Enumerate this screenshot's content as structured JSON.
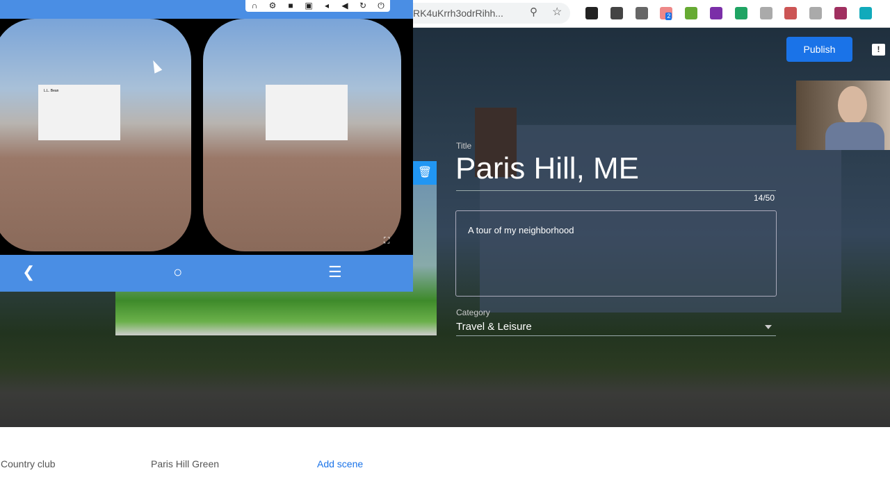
{
  "browser": {
    "url_fragment": "RK4uKrrh3odrRihh...",
    "extensions": [
      {
        "icon": "owl-icon",
        "color": "#222"
      },
      {
        "icon": "lightbulb-icon",
        "color": "#444"
      },
      {
        "icon": "aperture-icon",
        "color": "#666"
      },
      {
        "icon": "share-icon",
        "color": "#e88",
        "badge": "2"
      },
      {
        "icon": "play-icon",
        "color": "#6a3"
      },
      {
        "icon": "onenote-icon",
        "color": "#7b2fa8"
      },
      {
        "icon": "drive-icon",
        "color": "#1fa463"
      },
      {
        "icon": "pdf-icon",
        "color": "#aaa"
      },
      {
        "icon": "acrobat-icon",
        "color": "#c55"
      },
      {
        "icon": "drive-gray-icon",
        "color": "#aaa"
      },
      {
        "icon": "record-icon",
        "color": "#a03060"
      },
      {
        "icon": "c-icon",
        "color": "#1ab"
      }
    ]
  },
  "editor": {
    "publish_label": "Publish",
    "title_label": "Title",
    "title_value": "Paris Hill, ME",
    "title_count": "14/50",
    "description_value": "A tour of my neighborhood",
    "category_label": "Category",
    "category_value": "Travel & Leisure"
  },
  "emulator": {
    "top_icons": [
      "headphones-icon",
      "gear-icon",
      "video-icon",
      "camera-icon",
      "volume-down-icon",
      "volume-up-icon",
      "rotate-icon",
      "power-icon"
    ],
    "card_title": "L.L. Bean"
  },
  "scenes": {
    "items": [
      "Country club",
      "Paris Hill Green"
    ],
    "add_label": "Add scene"
  }
}
